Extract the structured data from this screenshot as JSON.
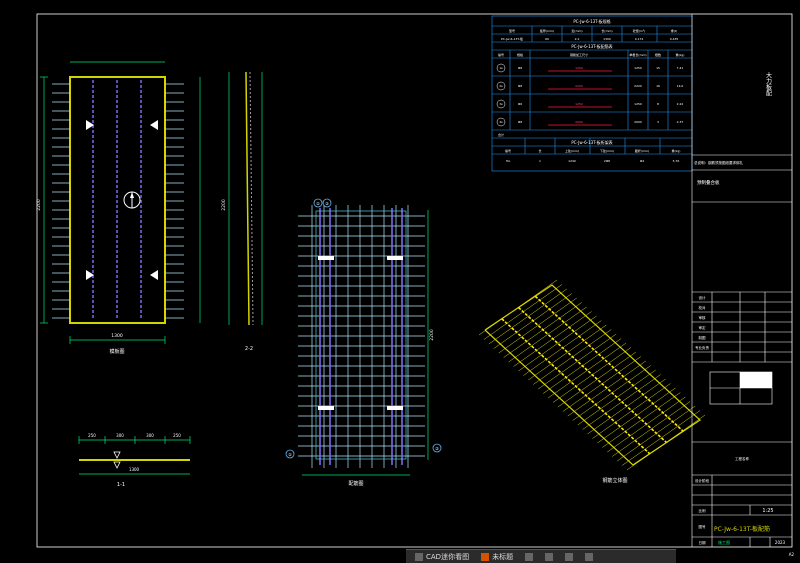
{
  "drawing": {
    "title_number": "PC-Jw-6-13T-板配筋",
    "scale": "1:25",
    "sheet_id": "A2",
    "year": "2023",
    "sec_label_22": "2-2",
    "sec_label_11": "1-1",
    "plan_label": "模板图",
    "rebar_plan_label": "配筋图",
    "iso_label": "钢筋立体图",
    "sheet_page": "1",
    "sheet_total": "1"
  },
  "right_panel": {
    "vertical_note": "大力板配",
    "note_line": "总说明：钢筋须按图纸要求绑扎",
    "sub_title": "预制叠合板"
  },
  "table": {
    "title_top": "PC-Jw-6-13T-板规格",
    "top_headers": [
      "型号",
      "板厚(mm)",
      "宽(mm)",
      "长(mm)",
      "砼量(m³)",
      "重(t)"
    ],
    "top_row": [
      "PC-Jw-6-13T-板",
      "60",
      "2.2",
      "1300",
      "0.174",
      "0.435"
    ],
    "title_mid": "PC-Jw-6-13T-板配筋表",
    "mid_headers": [
      "编号",
      "规格",
      "钢筋加工尺寸",
      "单根长(mm)",
      "根数",
      "重(kg)"
    ],
    "mid_rows": [
      {
        "id": "1a",
        "spec": "Φ8",
        "shape": "1250",
        "len": "1250",
        "num": "15",
        "wt": "7.41"
      },
      {
        "id": "2a",
        "spec": "Φ8",
        "shape": "2220",
        "len": "2220",
        "num": "16",
        "wt": "14.0"
      },
      {
        "id": "3a",
        "spec": "Φ6",
        "shape": "1250",
        "len": "1250",
        "num": "8",
        "wt": "2.22"
      },
      {
        "id": "4a",
        "spec": "Φ8",
        "shape": "2000",
        "len": "2000",
        "num": "3",
        "wt": "2.37"
      }
    ],
    "title_bottom": "PC-Jw-6-13T-板桁架表",
    "bot_headers": [
      "编号",
      "长",
      "上弦(mm)",
      "下弦(mm)",
      "腹杆(mm)",
      "重(kg)"
    ],
    "bot_row": [
      "HA",
      "1",
      "1240",
      "2Φ8",
      "Φ4",
      "5.76"
    ],
    "total_label": "合计"
  },
  "title_block": {
    "labels": [
      "设计",
      "校对",
      "审核",
      "审定",
      "制图",
      "专业负责"
    ],
    "scale_label": "比例",
    "drawing_no_label": "图号",
    "date_label": "日期",
    "project_label": "工程名称",
    "stage_label": "设计阶段",
    "stage_value": "施工图"
  },
  "dims": {
    "plan_width": "1300",
    "plan_length": "2200",
    "sec_width": "1300",
    "side_len": "2200",
    "rebar_len": "2200",
    "sec11_parts": [
      "250",
      "300",
      "300",
      "250"
    ]
  },
  "markers": {
    "grid_tl": "①",
    "grid_tm": "②",
    "grid_br": "②",
    "grid_bl": "①"
  },
  "taskbar": {
    "items": [
      "CAD迷你看图",
      "未标题",
      "",
      ""
    ]
  }
}
